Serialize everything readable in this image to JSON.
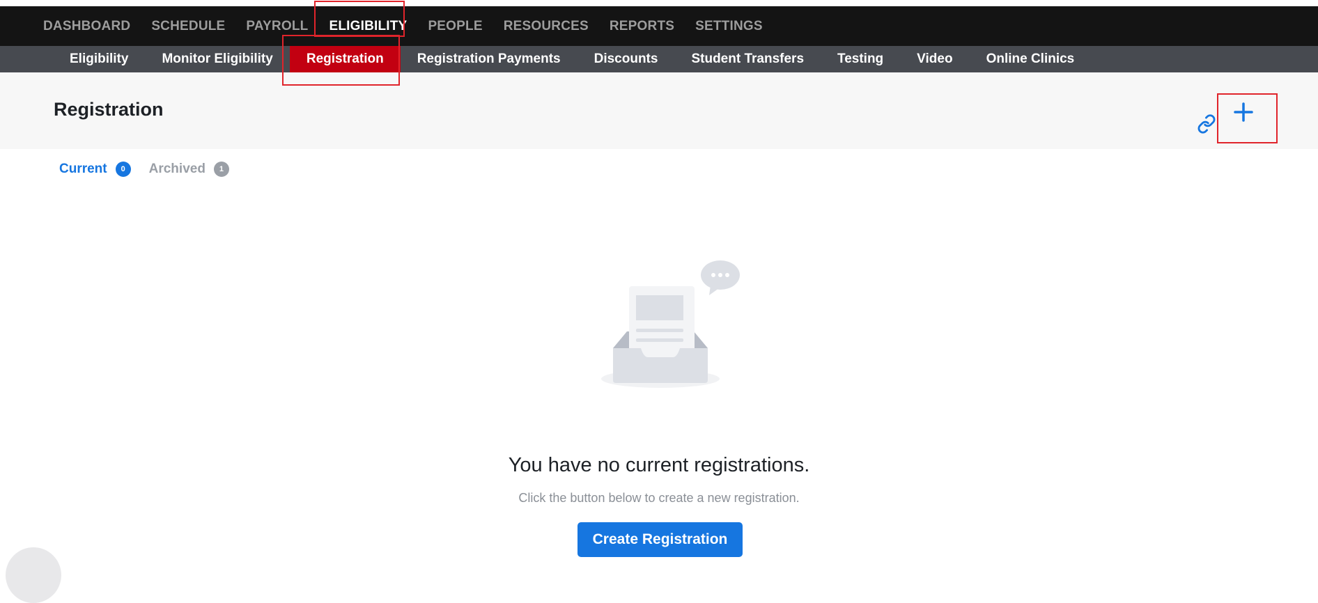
{
  "top_nav": {
    "items": [
      {
        "label": "DASHBOARD"
      },
      {
        "label": "SCHEDULE"
      },
      {
        "label": "PAYROLL"
      },
      {
        "label": "ELIGIBILITY",
        "active": true
      },
      {
        "label": "PEOPLE"
      },
      {
        "label": "RESOURCES"
      },
      {
        "label": "REPORTS"
      },
      {
        "label": "SETTINGS"
      }
    ]
  },
  "sub_nav": {
    "items": [
      {
        "label": "Eligibility"
      },
      {
        "label": "Monitor Eligibility"
      },
      {
        "label": "Registration",
        "active": true
      },
      {
        "label": "Registration Payments"
      },
      {
        "label": "Discounts"
      },
      {
        "label": "Student Transfers"
      },
      {
        "label": "Testing"
      },
      {
        "label": "Video"
      },
      {
        "label": "Online Clinics"
      }
    ]
  },
  "header": {
    "title": "Registration",
    "add_icon": "plus-icon",
    "link_icon": "link-icon"
  },
  "tabs": [
    {
      "label": "Current",
      "count": "0"
    },
    {
      "label": "Archived",
      "count": "1"
    }
  ],
  "empty_state": {
    "title": "You have no current registrations.",
    "subtitle": "Click the button below to create a new registration.",
    "button_label": "Create Registration",
    "illustration_icon": "empty-inbox-icon"
  },
  "colors": {
    "primary": "#1676e0",
    "active_subnav": "#c20011",
    "topbar": "#141414",
    "subbar": "#474a50",
    "highlight": "#e0242b"
  }
}
